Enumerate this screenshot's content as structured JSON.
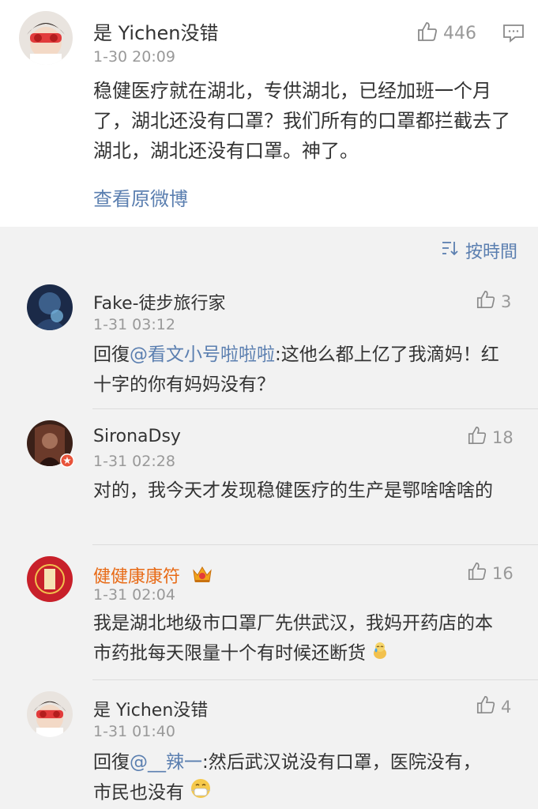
{
  "main_comment": {
    "user": "是 Yichen没错",
    "like_count": "446",
    "time": "1-30 20:09",
    "text": "稳健医疗就在湖北，专供湖北，已经加班一个月了，湖北还没有口罩？我们所有的口罩都拦截去了湖北，湖北还没有口罩。神了。",
    "view_origin": "查看原微博"
  },
  "sort_label": "按時間",
  "replies": [
    {
      "user": "Fake-徒步旅行家",
      "time": "1-31 03:12",
      "likes": "3",
      "prefix": "回復",
      "mention": "@看文小号啦啦啦",
      "text": ":这他么都上亿了我滴妈！红十字的你有妈妈没有？"
    },
    {
      "user": "SironaDsy",
      "time": "1-31 02:28",
      "likes": "18",
      "text": "对的，我今天才发现稳健医疗的生产是鄂啥啥啥的"
    },
    {
      "user": "健健康康符",
      "time": "1-31 02:04",
      "likes": "16",
      "text": "我是湖北地级市口罩厂先供武汉，我妈开药店的本市药批每天限量十个有时候还断货"
    },
    {
      "user": "是 Yichen没错",
      "time": "1-31 01:40",
      "likes": "4",
      "prefix": "回復",
      "mention": "@__辣一",
      "text": ":然后武汉说没有口罩，医院没有，市民也没有"
    }
  ]
}
